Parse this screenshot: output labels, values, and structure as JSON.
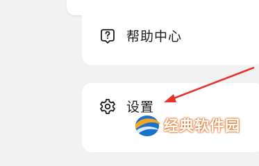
{
  "menu": {
    "help_label": "帮助中心",
    "help_icon": "help-question-icon",
    "settings_label": "设置",
    "settings_icon": "gear-icon"
  },
  "annotation": {
    "arrow_color": "#e8322d"
  },
  "watermark": {
    "text": "经典软件园",
    "accent_color": "#e0772c",
    "logo_colors": [
      "#f5a623",
      "#1a73c8"
    ]
  }
}
